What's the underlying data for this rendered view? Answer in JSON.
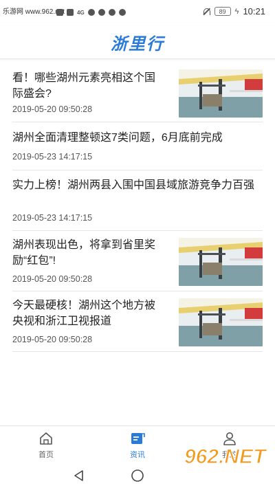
{
  "status_bar": {
    "watermark": "乐游网 www.962.net",
    "network": "4G",
    "battery": "89",
    "time": "10:21"
  },
  "header": {
    "title": "浙里行"
  },
  "news": [
    {
      "title": "看！哪些湖州元素亮相这个国际盛会?",
      "date": "2019-05-20 09:50:28",
      "has_image": true
    },
    {
      "title": "湖州全面清理整顿这7类问题，6月底前完成",
      "date": "2019-05-23 14:17:15",
      "has_image": false
    },
    {
      "title": "实力上榜！湖州两县入围中国县域旅游竞争力百强",
      "date": "2019-05-23 14:17:15",
      "has_image": false
    },
    {
      "title": "湖州表现出色，将拿到省里奖励“红包”!",
      "date": "2019-05-20 09:50:28",
      "has_image": true
    },
    {
      "title": "今天最硬核！湖州这个地方被央视和浙江卫视报道",
      "date": "2019-05-20 09:50:28",
      "has_image": true
    }
  ],
  "tabs": [
    {
      "label": "首页",
      "icon": "home-icon",
      "active": false
    },
    {
      "label": "资讯",
      "icon": "news-icon",
      "active": true
    },
    {
      "label": "我的",
      "icon": "user-icon",
      "active": false
    }
  ],
  "watermark_stamp": {
    "brand": "962.NET",
    "subtitle": "乐游网"
  },
  "colors": {
    "accent": "#2a7bd8",
    "text": "#222222",
    "date": "#555555",
    "divider": "#e5e5e5"
  }
}
